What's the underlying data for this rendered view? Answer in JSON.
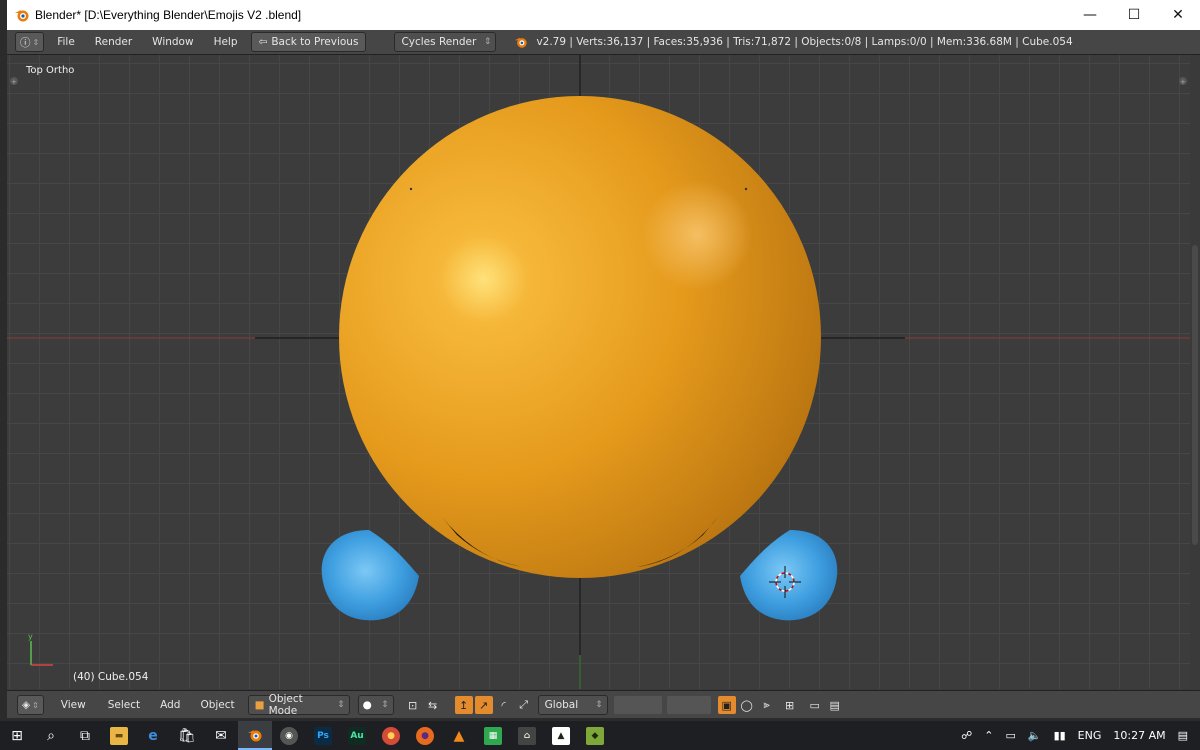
{
  "window": {
    "title": "Blender* [D:\\Everything Blender\\Emojis V2 .blend]",
    "minimize": "—",
    "maximize": "☐",
    "close": "✕"
  },
  "info_header": {
    "menus": [
      "File",
      "Render",
      "Window",
      "Help"
    ],
    "back_button": "Back to Previous",
    "render_engine": "Cycles Render",
    "stats": "v2.79 | Verts:36,137 | Faces:35,936 | Tris:71,872 | Objects:0/8 | Lamps:0/0 | Mem:336.68M | Cube.054"
  },
  "viewport": {
    "view_label": "Top Ortho",
    "object_label": "(40) Cube.054",
    "colors": {
      "face": "#f0a020",
      "face_dark": "#b86f10",
      "hand": "#4aa8e6",
      "grid": "#474747"
    }
  },
  "view_header": {
    "menus": [
      "View",
      "Select",
      "Add",
      "Object"
    ],
    "mode": "Object Mode",
    "orientation": "Global"
  },
  "taskbar": {
    "language": "ENG",
    "time": "10:27 AM"
  }
}
